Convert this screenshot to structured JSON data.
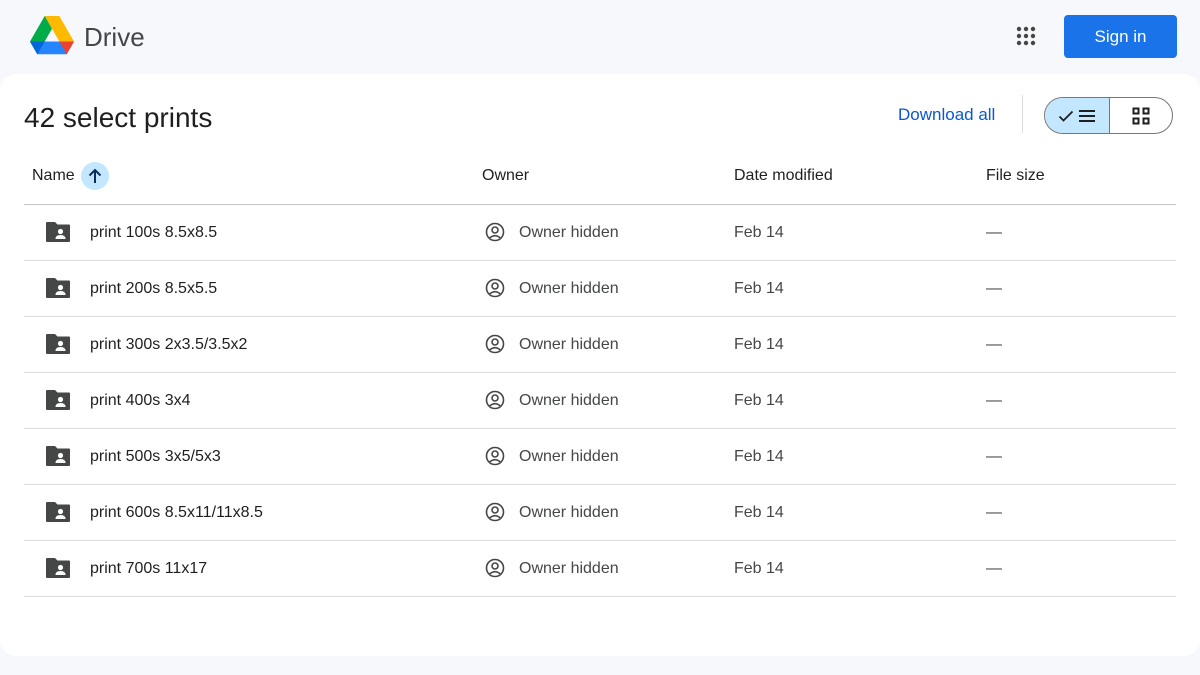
{
  "app": {
    "name": "Drive",
    "sign_in_label": "Sign in",
    "accent_color": "#1a73e8"
  },
  "page": {
    "title": "42 select prints",
    "download_all_label": "Download all",
    "view_mode": "list"
  },
  "columns": {
    "name": "Name",
    "owner": "Owner",
    "date_modified": "Date modified",
    "file_size": "File size",
    "sort": "ascending"
  },
  "rows": [
    {
      "name": "print 100s 8.5x8.5",
      "owner": "Owner hidden",
      "date": "Feb 14",
      "size": "—",
      "icon": "shared-folder-icon"
    },
    {
      "name": "print 200s 8.5x5.5",
      "owner": "Owner hidden",
      "date": "Feb 14",
      "size": "—",
      "icon": "shared-folder-icon"
    },
    {
      "name": "print 300s 2x3.5/3.5x2",
      "owner": "Owner hidden",
      "date": "Feb 14",
      "size": "—",
      "icon": "shared-folder-icon"
    },
    {
      "name": "print 400s 3x4",
      "owner": "Owner hidden",
      "date": "Feb 14",
      "size": "—",
      "icon": "shared-folder-icon"
    },
    {
      "name": "print 500s 3x5/5x3",
      "owner": "Owner hidden",
      "date": "Feb 14",
      "size": "—",
      "icon": "shared-folder-icon"
    },
    {
      "name": "print 600s 8.5x11/11x8.5",
      "owner": "Owner hidden",
      "date": "Feb 14",
      "size": "—",
      "icon": "shared-folder-icon"
    },
    {
      "name": "print 700s 11x17",
      "owner": "Owner hidden",
      "date": "Feb 14",
      "size": "—",
      "icon": "shared-folder-icon"
    }
  ]
}
